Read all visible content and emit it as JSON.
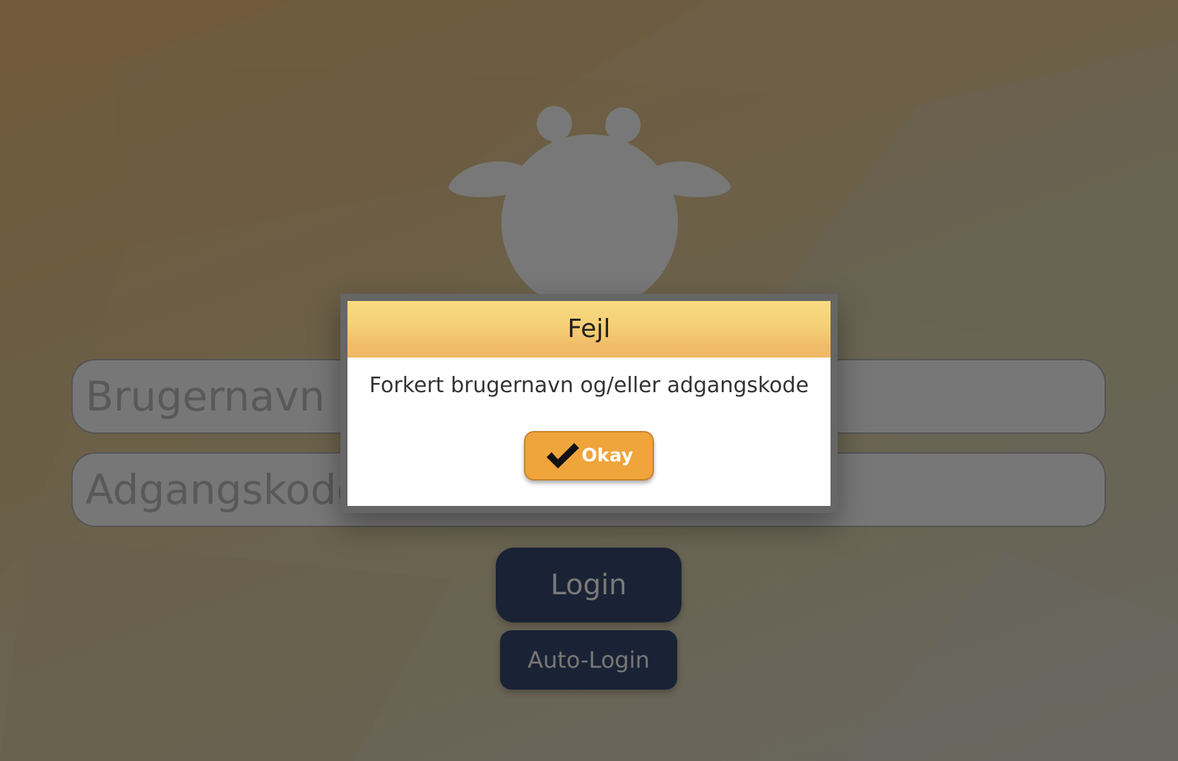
{
  "login": {
    "username_placeholder": "Brugernavn",
    "password_placeholder": "Adgangskode",
    "login_label": "Login",
    "auto_login_label": "Auto-Login"
  },
  "dialog": {
    "title": "Fejl",
    "message": "Forkert brugernavn og/eller adgangskode",
    "ok_label": "Okay",
    "ok_icon": "checkmark-icon"
  },
  "colors": {
    "dialog_header": "#f5cf76",
    "okay_button": "#f0a43c",
    "login_button": "#1a2335"
  }
}
